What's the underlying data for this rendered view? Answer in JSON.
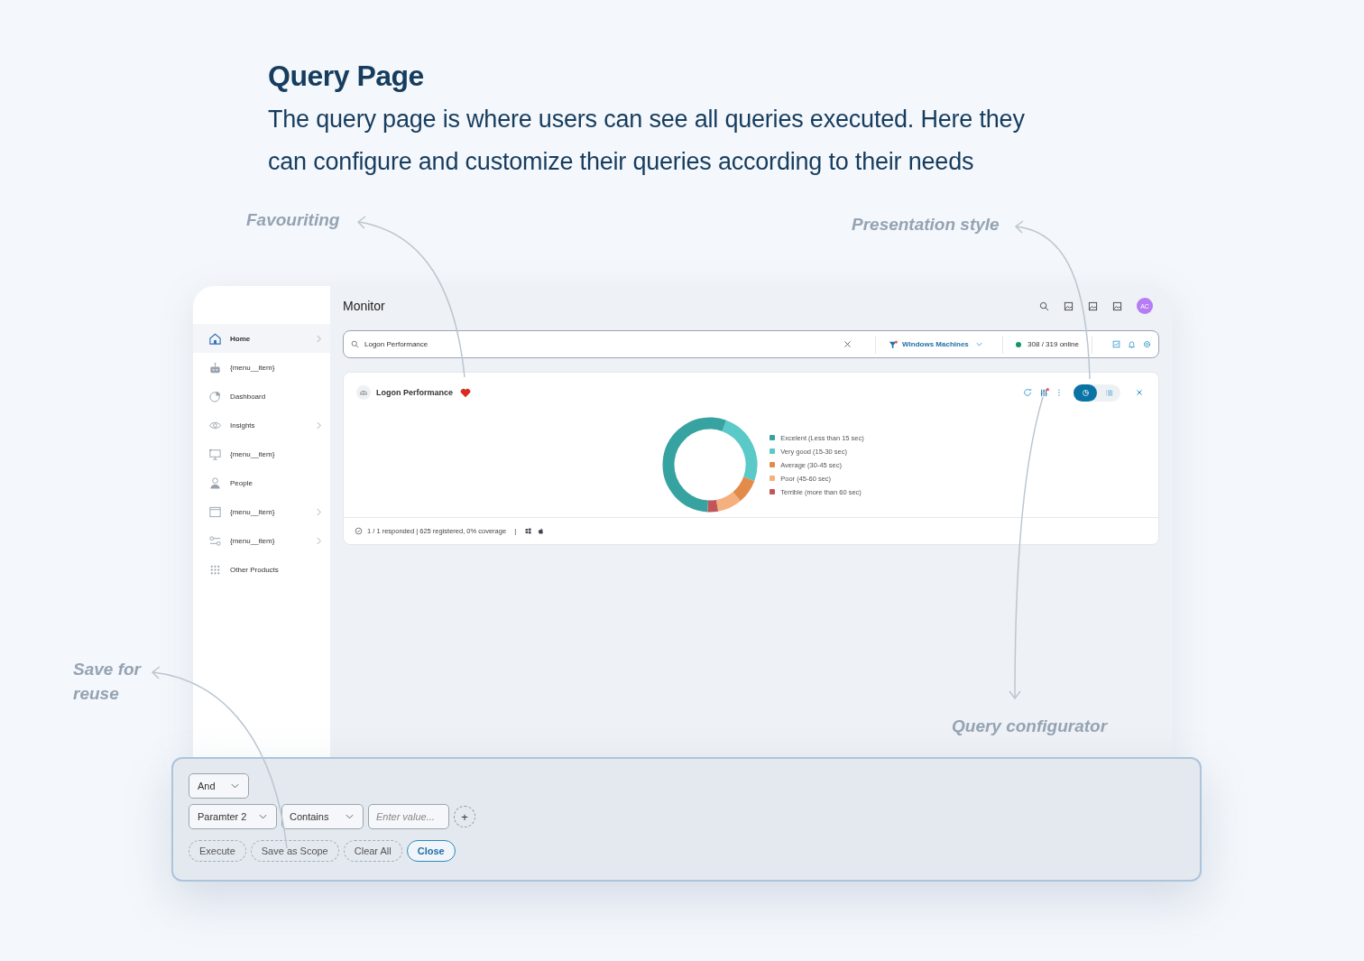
{
  "heading": {
    "title": "Query Page",
    "description": "The query page is where users can see all queries executed. Here they can configure and customize their queries according to their needs"
  },
  "annotations": [
    {
      "text": "Favouriting"
    },
    {
      "text": "Presentation style"
    },
    {
      "text": "Save for reuse"
    },
    {
      "text": "Query configurator"
    }
  ],
  "sidebar": {
    "items": [
      {
        "kind": "home",
        "label": "Home",
        "selected": true,
        "expandable": true
      },
      {
        "kind": "robot",
        "label": "{menu__item}",
        "selected": false,
        "expandable": false
      },
      {
        "kind": "pie",
        "label": "Dashboard",
        "selected": false,
        "expandable": false
      },
      {
        "kind": "eye",
        "label": "Insights",
        "selected": false,
        "expandable": true
      },
      {
        "kind": "monitor",
        "label": "{menu__item}",
        "selected": false,
        "expandable": false
      },
      {
        "kind": "person",
        "label": "People",
        "selected": false,
        "expandable": false
      },
      {
        "kind": "window",
        "label": "{menu__item}",
        "selected": false,
        "expandable": true
      },
      {
        "kind": "toggles",
        "label": "{menu__item}",
        "selected": false,
        "expandable": true
      },
      {
        "kind": "grid",
        "label": "Other Products",
        "selected": false,
        "expandable": false
      }
    ]
  },
  "header": {
    "title": "Monitor",
    "avatar": "AC"
  },
  "search": {
    "value": "Logon Performance",
    "filter": "Windows Machines",
    "online": "308 / 319 online"
  },
  "card": {
    "title": "Logon Performance",
    "favourite": true,
    "view_toggle": [
      {
        "kind": "chart",
        "selected": true
      },
      {
        "kind": "list",
        "selected": false
      }
    ],
    "legend": [
      {
        "label": "Excelent (Less than 15 sec)",
        "color": "#36a3a0"
      },
      {
        "label": "Very good (15-30 sec)",
        "color": "#5cc9c9"
      },
      {
        "label": "Average (30-45 sec)",
        "color": "#e38b4b"
      },
      {
        "label": "Poor (45-60 sec)",
        "color": "#f5b07e"
      },
      {
        "label": "Terrible (more than 60 sec)",
        "color": "#c0555a"
      }
    ],
    "footer": "1 / 1 responded | 625 registered, 0% coverage",
    "separator": "|"
  },
  "configurator": {
    "operator": "And",
    "parameter": "Paramter 2",
    "condition": "Contains",
    "placeholder": "Enter value...",
    "plus": "+",
    "buttons": [
      {
        "kind": "dashed",
        "label": "Execute"
      },
      {
        "kind": "dashed",
        "label": "Save as Scope"
      },
      {
        "kind": "dashed",
        "label": "Clear All"
      },
      {
        "kind": "primary",
        "label": "Close"
      }
    ]
  }
}
